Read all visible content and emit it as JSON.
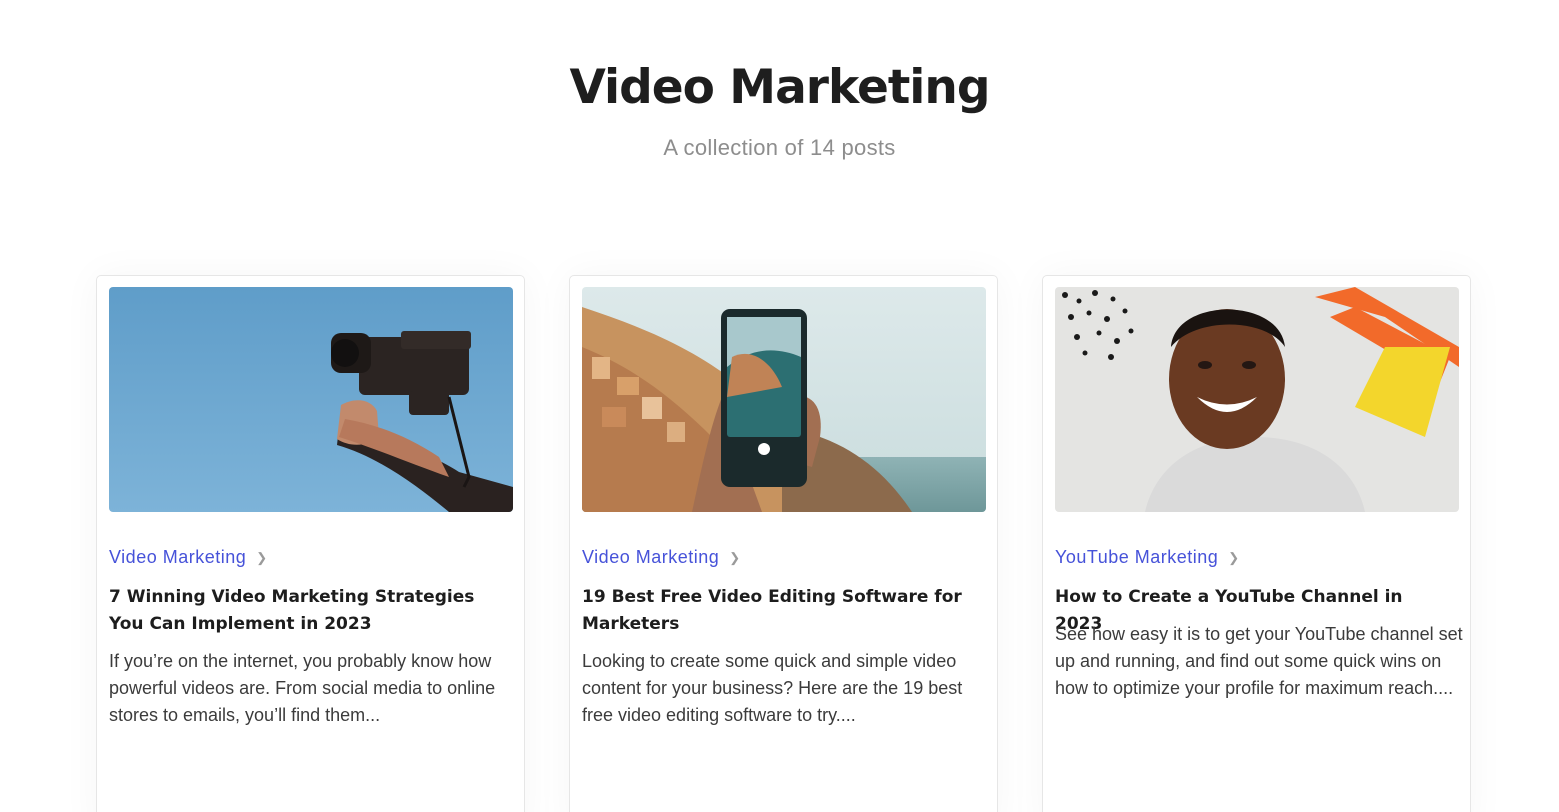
{
  "header": {
    "title": "Video Marketing",
    "subtitle": "A collection of 14 posts"
  },
  "colors": {
    "accent": "#4652d9",
    "title": "#1e1e1e",
    "subtitle": "#8d8d8d",
    "border": "#e6e6e6"
  },
  "posts": [
    {
      "category": "Video Marketing",
      "title": "7 Winning Video Marketing Strategies You Can Implement in 2023",
      "excerpt": "If you’re on the internet, you probably know how powerful videos are. From social media to online stores to emails, you’ll find them...",
      "image_icon": "camcorder-photo-icon"
    },
    {
      "category": "Video Marketing",
      "title": "19 Best Free Video Editing Software for Marketers",
      "excerpt": "Looking to create some quick and simple video content for your business? Here are the 19 best free video editing software to try....",
      "image_icon": "phone-photo-icon"
    },
    {
      "category": "YouTube Marketing",
      "title": "How to Create a YouTube Channel in 2023",
      "excerpt": "See how easy it is to get your YouTube channel set up and running, and find out some quick wins on how to optimize your profile for maximum reach....",
      "image_icon": "smiling-person-photo-icon"
    }
  ]
}
